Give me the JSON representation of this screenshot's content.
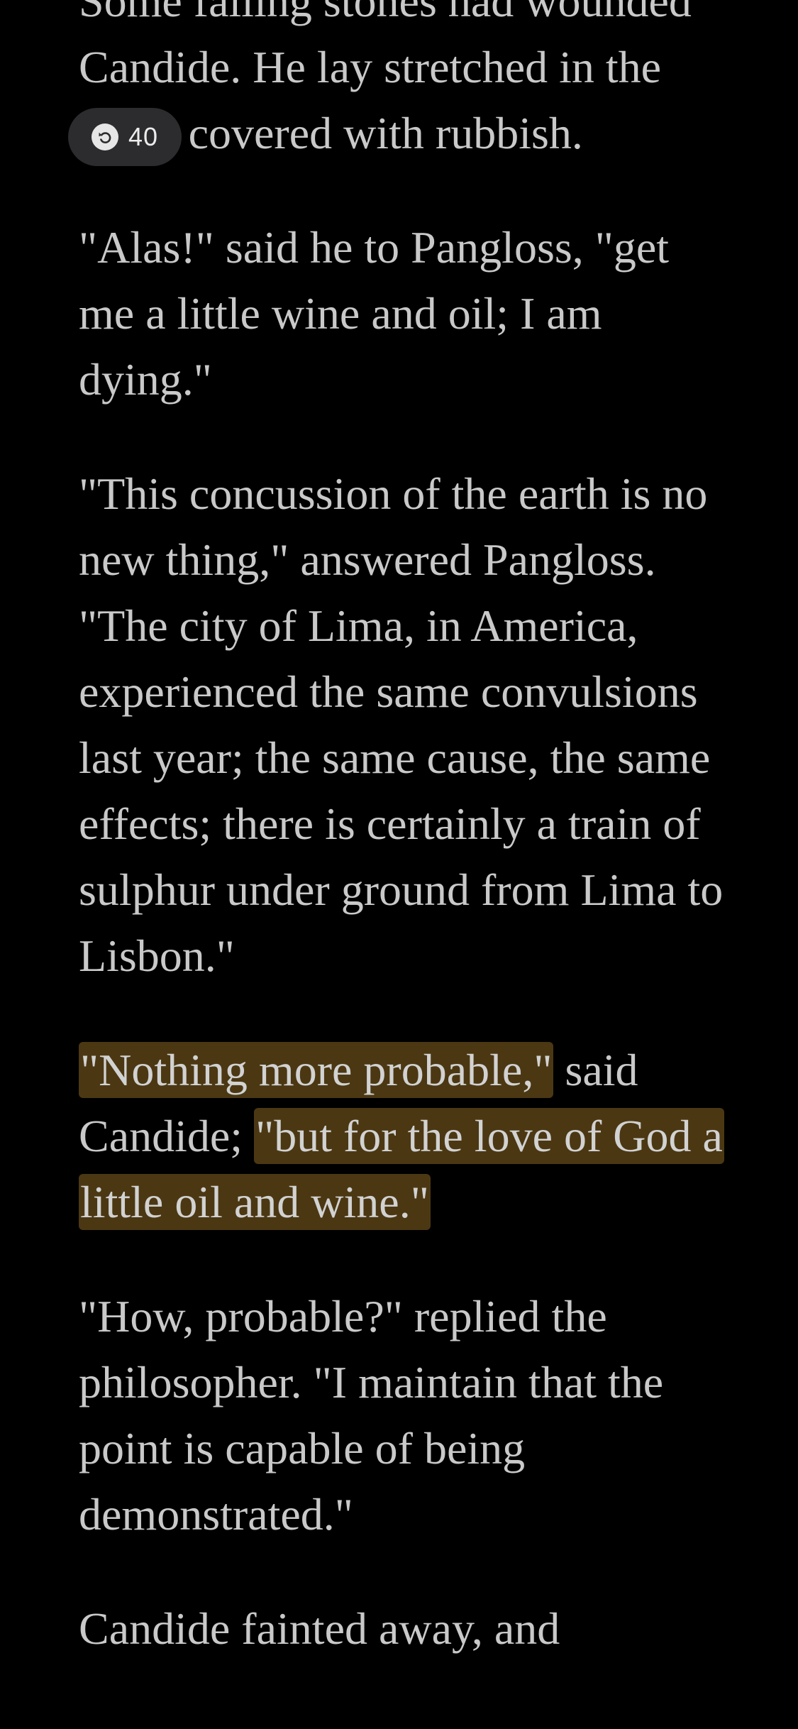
{
  "reader": {
    "paragraphs": [
      {
        "text": "Some falling stones had wounded Candide. He lay stretched in the street covered with rubbish."
      },
      {
        "text": "\"Alas!\" said he to Pangloss, \"get me a little wine and oil; I am dying.\""
      },
      {
        "text": "\"This concussion of the earth is no new thing,\" answered Pangloss. \"The city of Lima, in America, experienced the same convulsions last year; the same cause, the same effects; there is certainly a train of sulphur under ground from Lima to Lisbon.\""
      },
      {
        "seg1": "\"Nothing more probable,\"",
        "seg2": " said Candide; ",
        "seg3": "\"but for the love of God a little oil and wine.\""
      },
      {
        "text": "\"How, probable?\" replied the philosopher. \"I maintain that the point is capable of being demonstrated.\""
      },
      {
        "text": "Candide fainted away, and"
      }
    ]
  },
  "rewind": {
    "icon": "rewind-icon",
    "count": "40"
  },
  "colors": {
    "background": "#000000",
    "text": "#c9c9c9",
    "highlight": "#4b3813",
    "pill": "#2c2c2e"
  }
}
